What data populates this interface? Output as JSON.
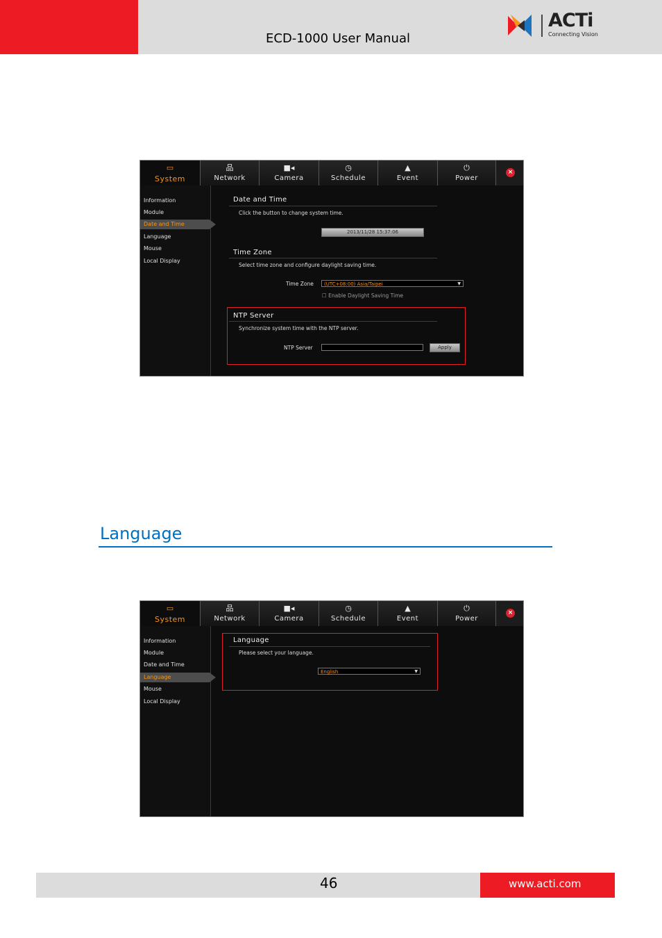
{
  "header": {
    "title": "ECD-1000 User Manual",
    "logo_text": "ACTi",
    "logo_tagline": "Connecting Vision",
    "colors": {
      "red": "#ed1c24",
      "gray": "#dcdcdc"
    }
  },
  "ui": {
    "tabs": {
      "system": "System",
      "network": "Network",
      "camera": "Camera",
      "schedule": "Schedule",
      "event": "Event",
      "power": "Power"
    },
    "icons": {
      "system": "monitor-icon",
      "network": "network-icon",
      "camera": "camera-icon",
      "schedule": "clock-icon",
      "event": "warning-icon",
      "power": "power-icon",
      "close": "close-icon"
    },
    "sidebar": {
      "items": [
        "Information",
        "Module",
        "Date and Time",
        "Language",
        "Mouse",
        "Local Display"
      ]
    },
    "accent_color": "#f7941d",
    "highlight_color": "#e21f26"
  },
  "screenshot1": {
    "active_item": "Date and Time",
    "date_time": {
      "title": "Date and Time",
      "desc": "Click the button to change system time.",
      "button": "2013/11/28 15:37:06"
    },
    "time_zone": {
      "title": "Time Zone",
      "desc": "Select time zone and configure daylight saving time.",
      "label": "Time Zone",
      "value": "(UTC+08:00) Asia/Taipei",
      "dst_label": "Enable Daylight Saving Time"
    },
    "ntp": {
      "title": "NTP Server",
      "desc": "Synchronize system time with the NTP server.",
      "label": "NTP Server",
      "value": "",
      "apply": "Apply"
    }
  },
  "section": {
    "heading": "Language"
  },
  "screenshot2": {
    "active_item": "Language",
    "language": {
      "title": "Language",
      "desc": "Please select your language.",
      "value": "English"
    }
  },
  "footer": {
    "page_number": "46",
    "url": "www.acti.com"
  }
}
